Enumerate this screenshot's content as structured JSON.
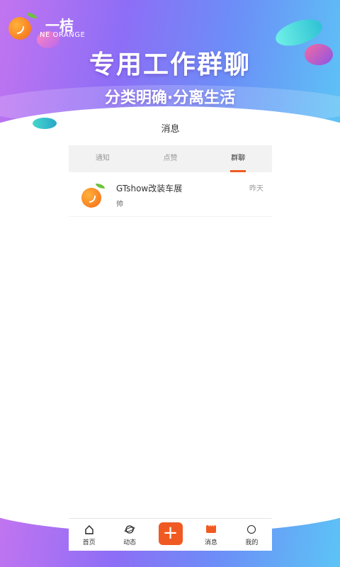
{
  "banner": {
    "logo_cn": "一桔",
    "logo_en": "NE ORANGE",
    "headline": "专用工作群聊",
    "subline": "分类明确·分离生活"
  },
  "panel": {
    "title": "消息",
    "tabs": [
      {
        "label": "通知",
        "active": false
      },
      {
        "label": "点赞",
        "active": false
      },
      {
        "label": "群聊",
        "active": true
      }
    ],
    "chats": [
      {
        "name": "GTshow改装车展",
        "time": "昨天",
        "preview": "帅"
      }
    ]
  },
  "nav": {
    "items": [
      {
        "label": "首页",
        "icon": "home-icon"
      },
      {
        "label": "动态",
        "icon": "orbit-icon"
      },
      {
        "label": "+",
        "icon": "plus-icon"
      },
      {
        "label": "消息",
        "icon": "message-icon"
      },
      {
        "label": "我的",
        "icon": "profile-icon"
      }
    ]
  },
  "colors": {
    "accent": "#f05a22",
    "gradient_start": "#c274f0",
    "gradient_end": "#5cc4f6"
  }
}
